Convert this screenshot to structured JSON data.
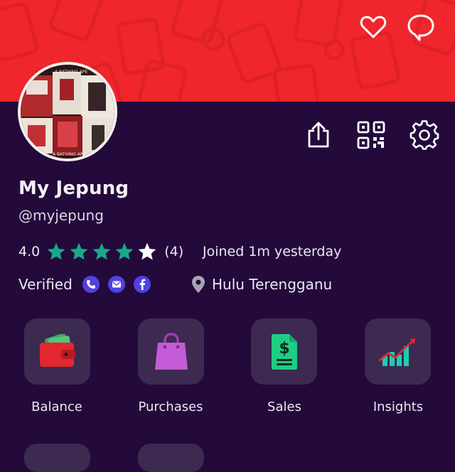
{
  "profile": {
    "name": "My Jepung",
    "handle": "@myjepung",
    "rating": "4.0",
    "rating_value": 4,
    "rating_max": 5,
    "rating_count": "(4)",
    "joined": "Joined 1m yesterday",
    "verified_label": "Verified",
    "location": "Hulu Terengganu"
  },
  "avatar": {
    "poster_texts": [
      "A BATHING APE",
      "A BATHING APE"
    ]
  },
  "header_icons": [
    "heart-icon",
    "chat-icon"
  ],
  "action_icons": [
    "share-icon",
    "qr-code-icon",
    "gear-icon"
  ],
  "verified_badges": [
    "phone-icon",
    "email-icon",
    "facebook-icon"
  ],
  "tiles": [
    {
      "label": "Balance",
      "icon": "wallet-icon"
    },
    {
      "label": "Purchases",
      "icon": "shopping-bag-icon"
    },
    {
      "label": "Sales",
      "icon": "dollar-document-icon"
    },
    {
      "label": "Insights",
      "icon": "chart-trend-icon"
    }
  ],
  "colors": {
    "banner": "#f0262d",
    "background": "#230a3b",
    "tile": "#3c2a51",
    "star": "#1aa988",
    "badge": "#5141e0"
  }
}
